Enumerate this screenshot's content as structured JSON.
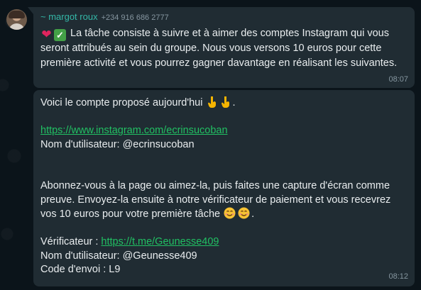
{
  "messages": [
    {
      "sender": {
        "name": "~ margot roux",
        "phone": "+234 916 686 2777"
      },
      "emojis": [
        "heart-emoji",
        "check-emoji"
      ],
      "text": "La tâche consiste à suivre et à aimer des comptes Instagram qui vous seront attribués au sein du groupe. Nous vous versons 10 euros pour cette première activité et vous pourrez gagner davantage en réalisant les suivantes.",
      "time": "08:07"
    },
    {
      "intro": "Voici le compte proposé aujourd'hui",
      "intro_end": ".",
      "instagram_link": "https://www.instagram.com/ecrinsucoban",
      "username_line": "Nom d'utilisateur: @ecrinsucoban",
      "paragraph": "Abonnez-vous à la page ou aimez-la, puis faites une capture d'écran comme preuve. Envoyez-la ensuite à notre vérificateur de paiement et vous recevrez vos 10 euros pour votre première tâche",
      "verifier_label": "Vérificateur : ",
      "verifier_link": "https://t.me/Geunesse409",
      "verifier_username": "Nom d'utilisateur: @Geunesse409",
      "send_code": "Code d'envoi : L9",
      "time": "08:12"
    }
  ],
  "colors": {
    "background": "#0b141a",
    "bubble": "#202c33",
    "sender_name": "#34b7a7",
    "link": "#53bdeb",
    "meta": "#8696a0"
  }
}
